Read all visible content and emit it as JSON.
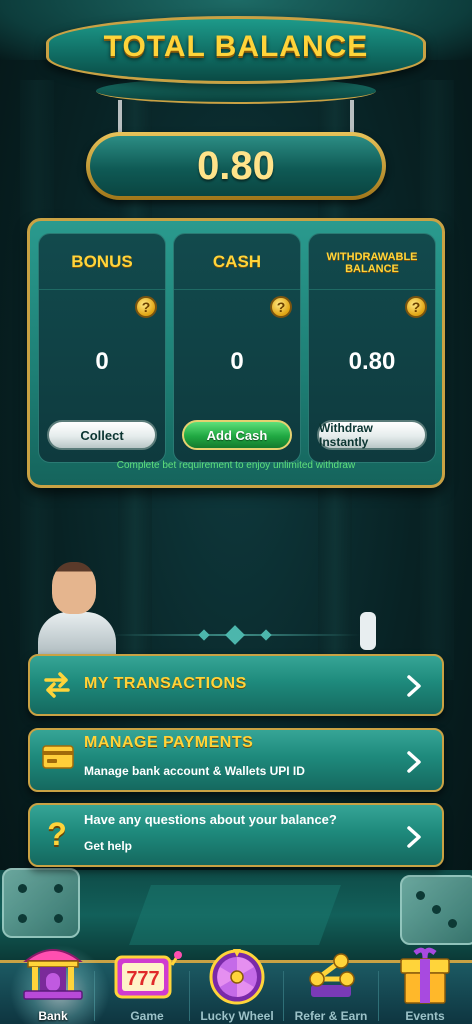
{
  "header": {
    "title": "TOTAL BALANCE",
    "total_balance": "0.80"
  },
  "wallet": {
    "cards": [
      {
        "label": "BONUS",
        "value": "0",
        "button": "Collect"
      },
      {
        "label": "CASH",
        "value": "0",
        "button": "Add Cash"
      },
      {
        "label": "WITHDRAWABLE BALANCE",
        "value": "0.80",
        "button": "Withdraw Instantly"
      }
    ],
    "help_glyph": "?",
    "note": "Complete bet requirement to enjoy unlimited withdraw"
  },
  "actions": {
    "transactions": {
      "title": "MY TRANSACTIONS",
      "icon": "swap-arrows-icon"
    },
    "payments": {
      "title": "MANAGE PAYMENTS",
      "subtitle": "Manage bank account & Wallets UPI ID",
      "icon": "card-icon"
    },
    "help": {
      "title": "Have any questions about your balance?",
      "subtitle": "Get help",
      "icon": "question-icon",
      "glyph": "?"
    }
  },
  "nav": {
    "items": [
      {
        "label": "Bank",
        "icon": "bank-icon",
        "active": true
      },
      {
        "label": "Game",
        "icon": "slot-777-icon",
        "slot_text": "777"
      },
      {
        "label": "Lucky Wheel",
        "icon": "wheel-icon"
      },
      {
        "label": "Refer & Earn",
        "icon": "refer-icon"
      },
      {
        "label": "Events",
        "icon": "gift-icon"
      }
    ]
  },
  "colors": {
    "gold": "#ffd43a",
    "teal": "#1e8a7c",
    "green_button": "#20a842",
    "note_green": "#60e07c"
  }
}
